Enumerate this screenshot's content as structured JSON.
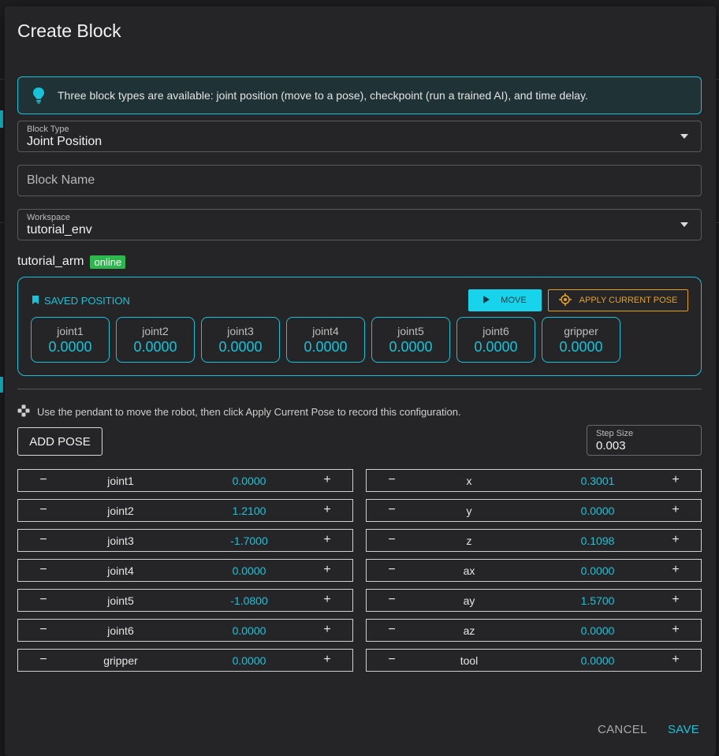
{
  "dialog": {
    "title": "Create Block",
    "info": "Three block types are available: joint position (move to a pose), checkpoint (run a trained AI), and time delay.",
    "block_type": {
      "label": "Block Type",
      "value": "Joint Position"
    },
    "block_name": {
      "placeholder": "Block Name"
    },
    "workspace": {
      "label": "Workspace",
      "value": "tutorial_env"
    },
    "arm": {
      "name": "tutorial_arm",
      "status": "online"
    },
    "saved_position": {
      "title": "SAVED POSITION",
      "move_label": "MOVE",
      "apply_label": "APPLY CURRENT POSE",
      "joints": [
        {
          "label": "joint1",
          "value": "0.0000"
        },
        {
          "label": "joint2",
          "value": "0.0000"
        },
        {
          "label": "joint3",
          "value": "0.0000"
        },
        {
          "label": "joint4",
          "value": "0.0000"
        },
        {
          "label": "joint5",
          "value": "0.0000"
        },
        {
          "label": "joint6",
          "value": "0.0000"
        },
        {
          "label": "gripper",
          "value": "0.0000"
        }
      ]
    },
    "hint": "Use the pendant to move the robot, then click Apply Current Pose to record this configuration.",
    "add_pose_label": "ADD POSE",
    "step_size": {
      "label": "Step Size",
      "value": "0.003"
    },
    "joint_controls": [
      {
        "name": "joint1",
        "value": "0.0000"
      },
      {
        "name": "joint2",
        "value": "1.2100"
      },
      {
        "name": "joint3",
        "value": "-1.7000"
      },
      {
        "name": "joint4",
        "value": "0.0000"
      },
      {
        "name": "joint5",
        "value": "-1.0800"
      },
      {
        "name": "joint6",
        "value": "0.0000"
      },
      {
        "name": "gripper",
        "value": "0.0000"
      }
    ],
    "cartesian_controls": [
      {
        "name": "x",
        "value": "0.3001"
      },
      {
        "name": "y",
        "value": "0.0000"
      },
      {
        "name": "z",
        "value": "0.1098"
      },
      {
        "name": "ax",
        "value": "0.0000"
      },
      {
        "name": "ay",
        "value": "1.5700"
      },
      {
        "name": "az",
        "value": "0.0000"
      },
      {
        "name": "tool",
        "value": "0.0000"
      }
    ],
    "minus_symbol": "−",
    "plus_symbol": "+",
    "cancel_label": "CANCEL",
    "save_label": "SAVE"
  },
  "colors": {
    "accent": "#17c3d8",
    "warning": "#e6a21e",
    "online": "#2db84d"
  },
  "icons": {
    "info": "lightbulb-icon",
    "saved": "bookmark-icon",
    "move": "play-icon",
    "apply": "crosshair-icon",
    "hint": "gamepad-icon"
  }
}
